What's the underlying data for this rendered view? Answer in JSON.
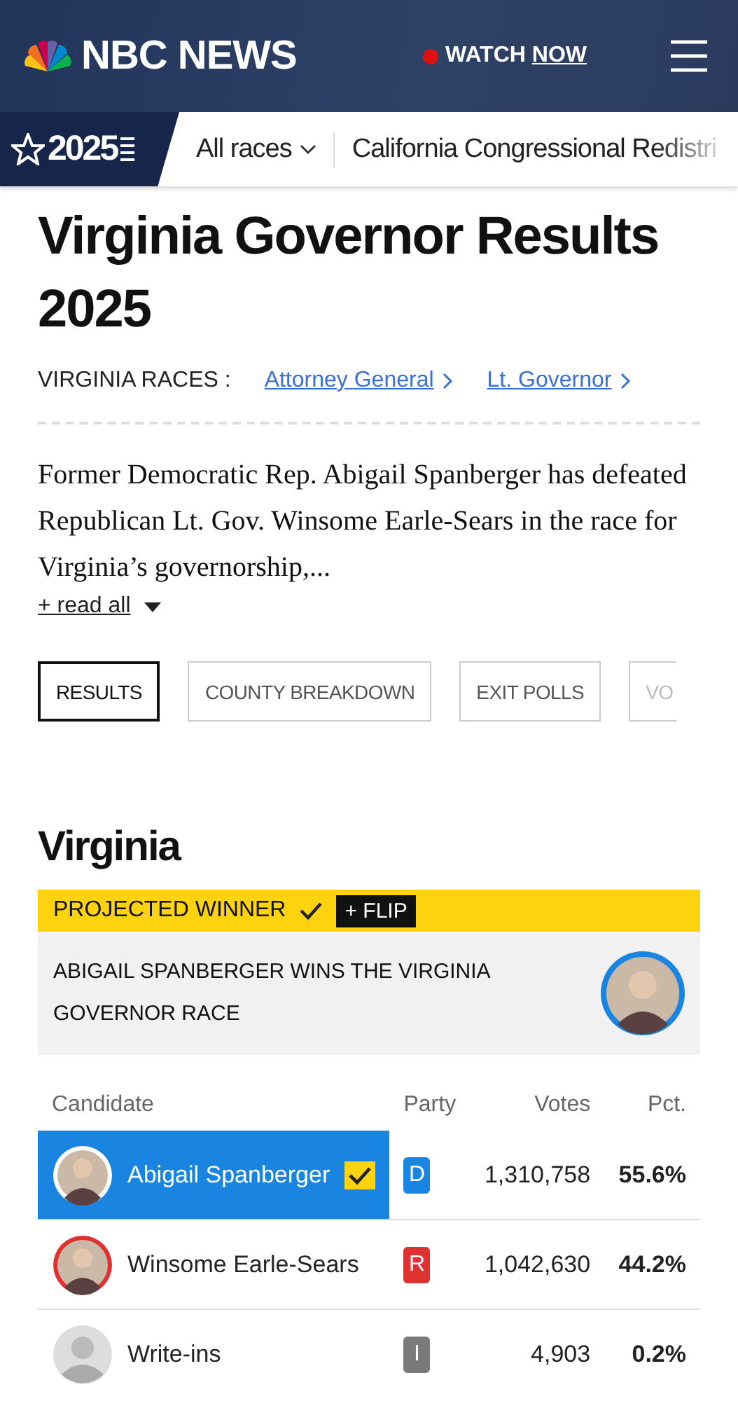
{
  "header": {
    "logo": "NBC NEWS",
    "watch": "WATCH",
    "watch_now": "NOW",
    "live": true
  },
  "subnav": {
    "badge": "2025",
    "items": [
      {
        "label": "All races",
        "dropdown": true
      },
      {
        "label": "California Congressional Redistri",
        "dropdown": false
      }
    ]
  },
  "title": "Virginia Governor Results 2025",
  "races": {
    "label": "VIRGINIA RACES :",
    "links": [
      "Attorney General",
      "Lt. Governor"
    ]
  },
  "summary": "Former Democratic Rep. Abigail Spanberger has defeated Republican Lt. Gov. Winsome Earle-Sears in the race for Virginia’s governorship,...",
  "read_all": "+ read all",
  "tabs": [
    {
      "label": "RESULTS",
      "selected": true
    },
    {
      "label": "COUNTY BREAKDOWN",
      "selected": false
    },
    {
      "label": "EXIT POLLS",
      "selected": false
    },
    {
      "label": "VO",
      "selected": false
    }
  ],
  "state": "Virginia",
  "winner_banner": {
    "label": "PROJECTED WINNER",
    "flip": "+ FLIP",
    "headline": "ABIGAIL SPANBERGER WINS THE VIRGINIA GOVERNOR RACE"
  },
  "table": {
    "columns": [
      "Candidate",
      "Party",
      "Votes",
      "Pct."
    ],
    "rows": [
      {
        "name": "Abigail Spanberger",
        "party": "D",
        "color": "#1a85e0",
        "votes": "1,310,758",
        "pct": "55.6%",
        "selected": true,
        "winner": true,
        "kind": "photo"
      },
      {
        "name": "Winsome Earle-Sears",
        "party": "R",
        "color": "#e03131",
        "votes": "1,042,630",
        "pct": "44.2%",
        "selected": false,
        "winner": false,
        "kind": "photo"
      },
      {
        "name": "Write-ins",
        "party": "I",
        "color": "#7a7a7a",
        "votes": "4,903",
        "pct": "0.2%",
        "selected": false,
        "winner": false,
        "kind": "placeholder"
      }
    ]
  }
}
